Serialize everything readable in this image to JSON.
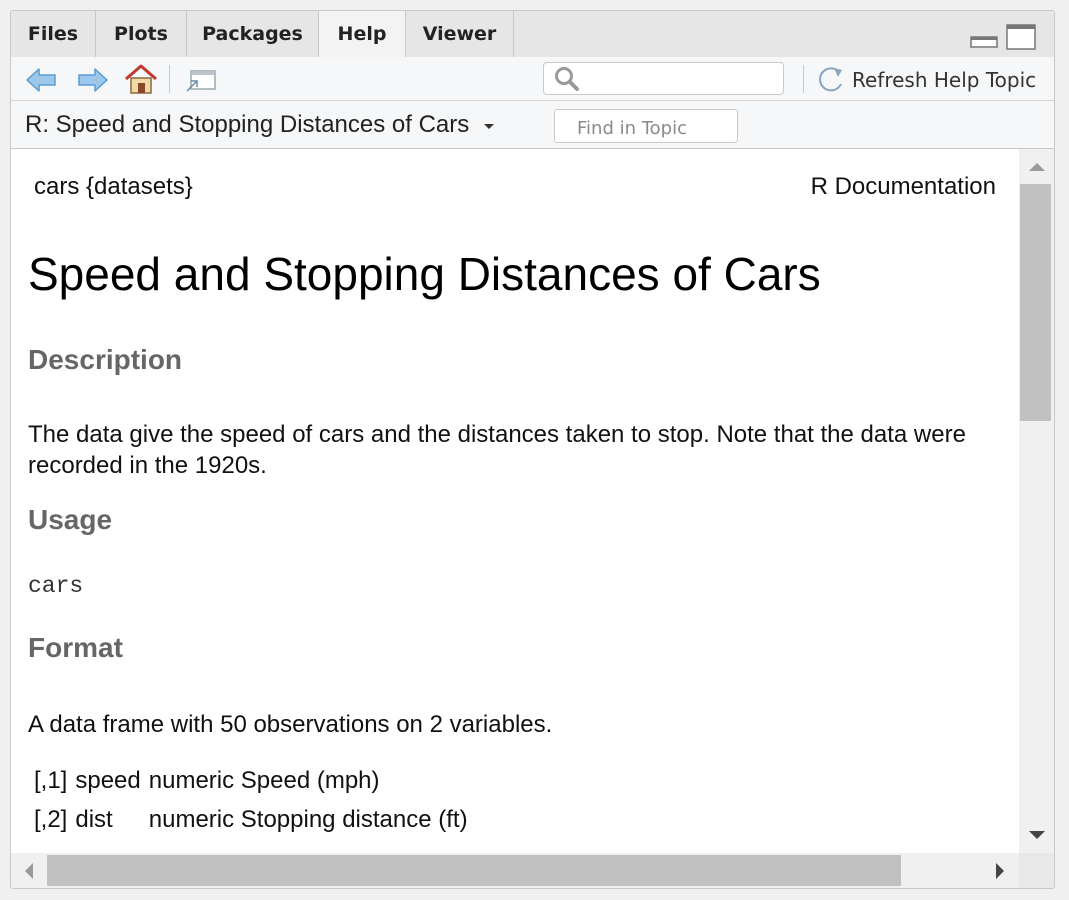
{
  "tabs": [
    {
      "label": "Files"
    },
    {
      "label": "Plots"
    },
    {
      "label": "Packages"
    },
    {
      "label": "Help",
      "active": true
    },
    {
      "label": "Viewer"
    }
  ],
  "toolbar": {
    "search_value": "",
    "refresh_label": "Refresh Help Topic",
    "icons": [
      "back-arrow-icon",
      "forward-arrow-icon",
      "home-icon",
      "popout-icon",
      "search-icon",
      "refresh-icon"
    ]
  },
  "topic_bar": {
    "topic_label": "R: Speed and Stopping Distances of Cars",
    "find_placeholder": "Find in Topic"
  },
  "doc": {
    "header_left": "cars {datasets}",
    "header_right": "R Documentation",
    "title": "Speed and Stopping Distances of Cars",
    "description_heading": "Description",
    "description_text": "The data give the speed of cars and the distances taken to stop. Note that the data were recorded in the 1920s.",
    "usage_heading": "Usage",
    "usage_code": "cars",
    "format_heading": "Format",
    "format_text": "A data frame with 50 observations on 2 variables.",
    "format_rows": [
      {
        "index": "[,1]",
        "name": "speed",
        "desc": "numeric Speed (mph)"
      },
      {
        "index": "[,2]",
        "name": "dist",
        "desc": "numeric Stopping distance (ft)"
      }
    ]
  },
  "colors": {
    "accent_blue": "#6aa7d8",
    "home_red": "#c0392b",
    "heading_gray": "#666666"
  }
}
